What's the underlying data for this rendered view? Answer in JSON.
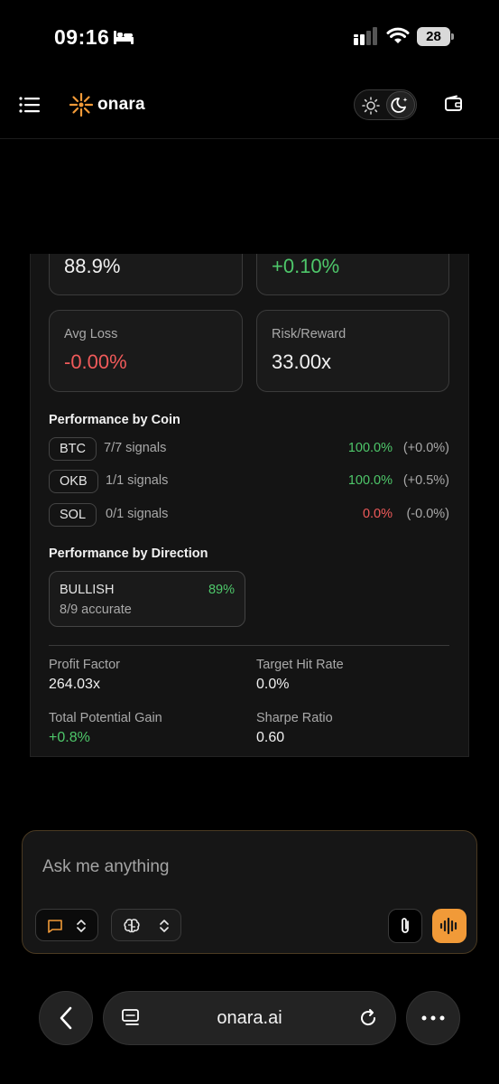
{
  "status_bar": {
    "time": "09:16",
    "battery": "28"
  },
  "header": {
    "brand": "onara"
  },
  "stats": {
    "win_rate_value": "88.9%",
    "avg_gain_value": "+0.10%",
    "avg_loss_label": "Avg Loss",
    "avg_loss_value": "-0.00%",
    "risk_reward_label": "Risk/Reward",
    "risk_reward_value": "33.00x"
  },
  "by_coin": {
    "title": "Performance by Coin",
    "rows": [
      {
        "coin": "BTC",
        "signals": "7/7 signals",
        "pct": "100.0%",
        "delta": "(+0.0%)"
      },
      {
        "coin": "OKB",
        "signals": "1/1 signals",
        "pct": "100.0%",
        "delta": "(+0.5%)"
      },
      {
        "coin": "SOL",
        "signals": "0/1 signals",
        "pct": "0.0%",
        "delta": "(-0.0%)"
      }
    ]
  },
  "by_direction": {
    "title": "Performance by Direction",
    "name": "BULLISH",
    "pct": "89%",
    "sub": "8/9 accurate"
  },
  "metrics": {
    "profit_factor_label": "Profit Factor",
    "profit_factor_value": "264.03x",
    "target_hit_label": "Target Hit Rate",
    "target_hit_value": "0.0%",
    "potential_gain_label": "Total Potential Gain",
    "potential_gain_value": "+0.8%",
    "sharpe_label": "Sharpe Ratio",
    "sharpe_value": "0.60"
  },
  "chat": {
    "placeholder": "Ask me anything"
  },
  "browser": {
    "url": "onara.ai"
  },
  "colors": {
    "accent": "#f19a38",
    "positive": "#4ec76a",
    "negative": "#ef5a5a"
  }
}
